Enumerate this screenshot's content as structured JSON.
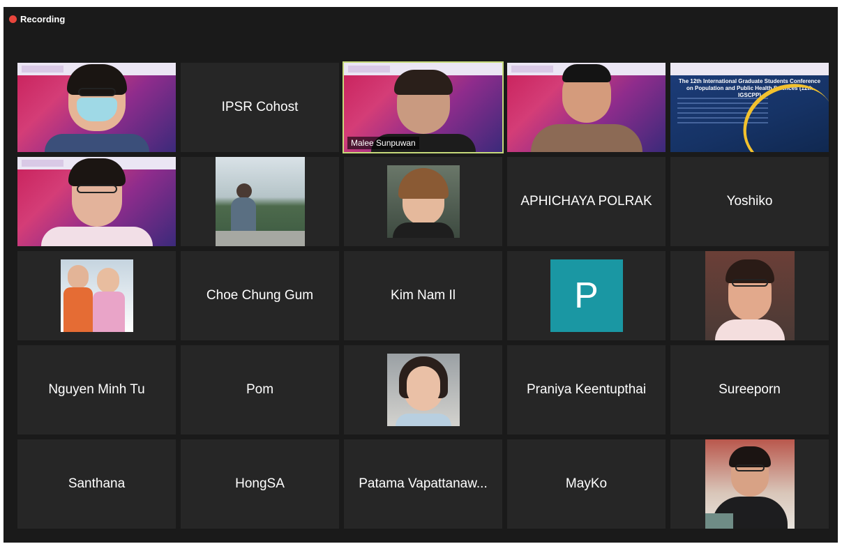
{
  "recording": {
    "label": "Recording",
    "color": "#e8453c"
  },
  "conference": {
    "title": "The 12th International Graduate Students Conference on Population and Public Health Sciences (12th IGSCPP)"
  },
  "participants": [
    {
      "name": "",
      "type": "video"
    },
    {
      "name": "IPSR Cohost",
      "type": "name"
    },
    {
      "name": "Malee Sunpuwan",
      "type": "video",
      "active": true
    },
    {
      "name": "",
      "type": "video"
    },
    {
      "name": "",
      "type": "slide"
    },
    {
      "name": "",
      "type": "video"
    },
    {
      "name": "",
      "type": "photo"
    },
    {
      "name": "",
      "type": "photo"
    },
    {
      "name": "APHICHAYA POLRAK",
      "type": "name"
    },
    {
      "name": "Yoshiko",
      "type": "name"
    },
    {
      "name": "",
      "type": "photo"
    },
    {
      "name": "Choe Chung Gum",
      "type": "name"
    },
    {
      "name": "Kim Nam Il",
      "type": "name"
    },
    {
      "name": "",
      "type": "avatar",
      "initial": "P",
      "color": "#1a97a3"
    },
    {
      "name": "",
      "type": "photo"
    },
    {
      "name": "Nguyen Minh Tu",
      "type": "name"
    },
    {
      "name": "Pom",
      "type": "name"
    },
    {
      "name": "",
      "type": "photo"
    },
    {
      "name": "Praniya Keentupthai",
      "type": "name"
    },
    {
      "name": "Sureeporn",
      "type": "name"
    },
    {
      "name": "Santhana",
      "type": "name"
    },
    {
      "name": "HongSA",
      "type": "name"
    },
    {
      "name": "Patama Vapattanaw...",
      "type": "name"
    },
    {
      "name": "MayKo",
      "type": "name"
    },
    {
      "name": "",
      "type": "photo"
    }
  ]
}
